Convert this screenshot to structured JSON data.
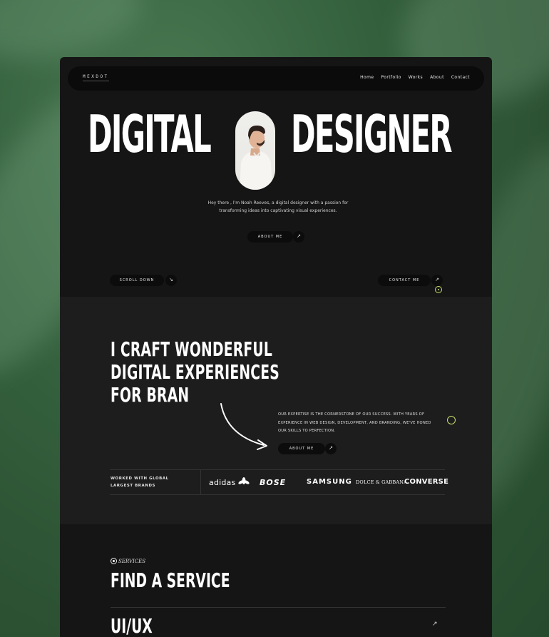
{
  "colors": {
    "background_green": "#2f5a38",
    "panel_dark": "#151515",
    "section_gray": "#1d1d1d",
    "accent_lime": "#c8e06a",
    "text_white": "#ffffff"
  },
  "nav": {
    "logo": "MEXDOT",
    "items": [
      {
        "label": "Home"
      },
      {
        "label": "Portfolio"
      },
      {
        "label": "Works"
      },
      {
        "label": "About"
      },
      {
        "label": "Contact"
      }
    ]
  },
  "hero": {
    "word_left": "DIGITAL",
    "word_right": "DESIGNER",
    "intro": "Hey there , I'm Noah Reeves, a digital designer with a passion for transforming ideas into captivating visual experiences.",
    "about_button": "ABOUT ME",
    "scroll_button": "SCROLL DOWN",
    "contact_button": "CONTACT ME",
    "arrow_icon": "arrow-up-right-icon"
  },
  "craft": {
    "lines": [
      "I CRAFT WONDERFUL",
      "DIGITAL EXPERIENCES",
      "FOR BRAN"
    ],
    "expertise": "OUR EXPERTISE IS THE CORNERSTONE OF OUR SUCCESS. WITH YEARS OF EXPERIENCE IN WEB DESIGN, DEVELOPMENT, AND BRANDING, WE'VE HONED OUR SKILLS TO PERFECTION.",
    "about_button": "ABOUT ME"
  },
  "brands": {
    "heading": "WORKED WITH GLOBAL LARGEST BRANDS",
    "logos": [
      "adidas",
      "BOSE",
      "SAMSUNG",
      "DOLCE & GABBANA",
      "CONVERSE"
    ]
  },
  "services": {
    "label": "SERVICES",
    "title": "FIND A SERVICE",
    "items": [
      {
        "name": "UI/UX"
      }
    ]
  }
}
